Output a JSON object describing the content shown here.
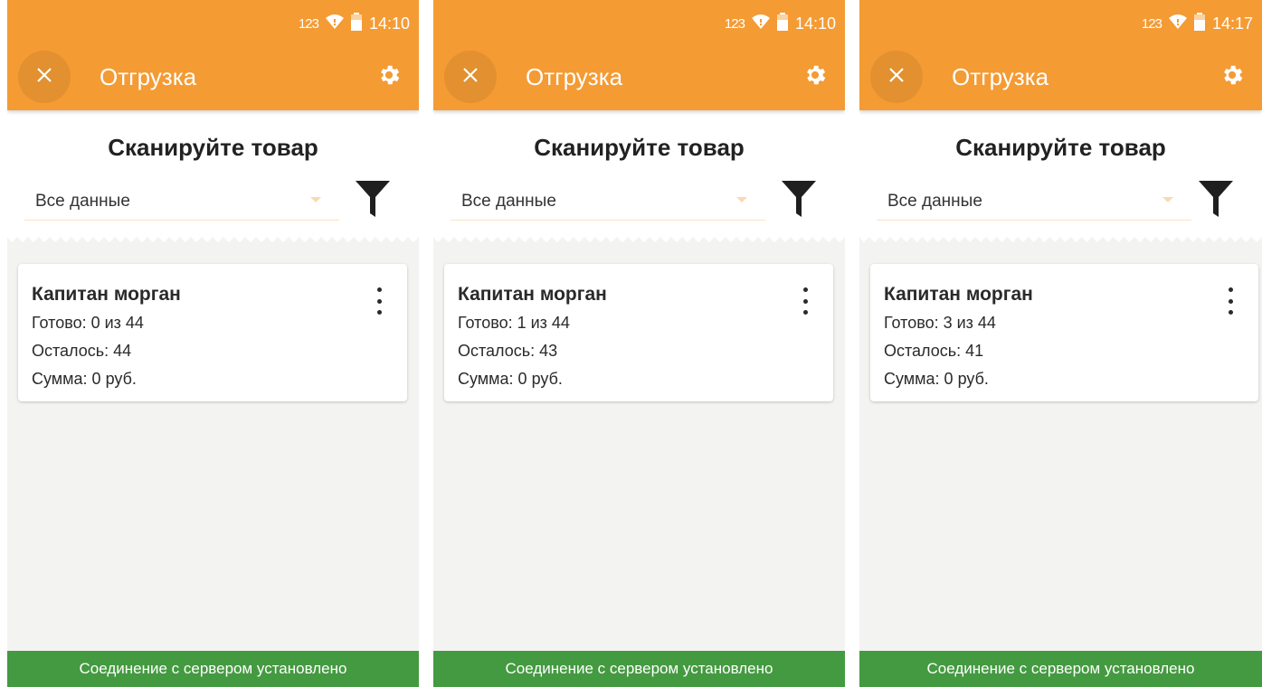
{
  "screens": [
    {
      "status": {
        "network": "123",
        "time": "14:10"
      },
      "appbar": {
        "title": "Отгрузка"
      },
      "scan_title": "Сканируйте товар",
      "filter": {
        "selected": "Все данные"
      },
      "card": {
        "title": "Капитан морган",
        "ready": "Готово: 0 из 44",
        "left": "Осталось: 44",
        "sum": "Сумма: 0 руб."
      },
      "server_status": "Соединение с сервером установлено"
    },
    {
      "status": {
        "network": "123",
        "time": "14:10"
      },
      "appbar": {
        "title": "Отгрузка"
      },
      "scan_title": "Сканируйте товар",
      "filter": {
        "selected": "Все данные"
      },
      "card": {
        "title": "Капитан морган",
        "ready": "Готово: 1 из 44",
        "left": "Осталось: 43",
        "sum": "Сумма: 0 руб."
      },
      "server_status": "Соединение с сервером установлено"
    },
    {
      "status": {
        "network": "123",
        "time": "14:17"
      },
      "appbar": {
        "title": "Отгрузка"
      },
      "scan_title": "Сканируйте товар",
      "filter": {
        "selected": "Все данные"
      },
      "card": {
        "title": "Капитан морган",
        "ready": "Готово: 3 из 44",
        "left": "Осталось: 41",
        "sum": "Сумма: 0 руб."
      },
      "server_status": "Соединение с сервером установлено"
    }
  ],
  "icons": {
    "close": "close-icon",
    "settings": "gear-icon",
    "filter": "filter-funnel-icon",
    "more": "more-vertical-icon",
    "wifi": "wifi-icon",
    "battery": "battery-icon"
  },
  "colors": {
    "appbar": "#f49b34",
    "status_ok": "#449a40",
    "background": "#f3f3f2"
  }
}
